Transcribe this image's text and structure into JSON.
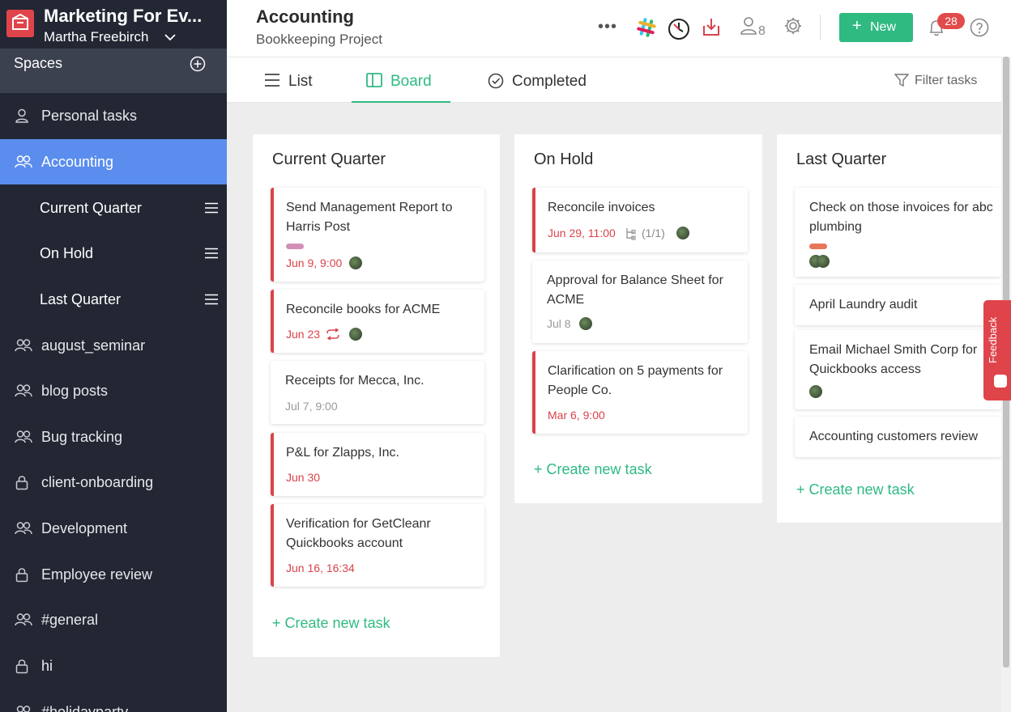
{
  "workspace": {
    "name": "Marketing For Ev...",
    "user": "Martha Freebirch"
  },
  "sidebar": {
    "spaces_label": "Spaces",
    "items": [
      {
        "label": "Personal tasks",
        "icon": "person-icon"
      },
      {
        "label": "Accounting",
        "icon": "people-icon",
        "active": true
      },
      {
        "label": "Current Quarter",
        "sub": true
      },
      {
        "label": "On Hold",
        "sub": true
      },
      {
        "label": "Last Quarter",
        "sub": true
      },
      {
        "label": "august_seminar",
        "icon": "people-icon"
      },
      {
        "label": "blog posts",
        "icon": "people-icon"
      },
      {
        "label": "Bug tracking",
        "icon": "people-icon"
      },
      {
        "label": "client-onboarding",
        "icon": "lock-icon"
      },
      {
        "label": "Development",
        "icon": "people-icon"
      },
      {
        "label": "Employee review",
        "icon": "lock-icon"
      },
      {
        "label": "#general",
        "icon": "people-icon"
      },
      {
        "label": "hi",
        "icon": "lock-icon"
      },
      {
        "label": "#holidayparty",
        "icon": "people-icon"
      }
    ]
  },
  "header": {
    "title": "Accounting",
    "subtitle": "Bookkeeping Project",
    "member_count": "8",
    "new_button": "New",
    "notifications": "28"
  },
  "tabs": [
    {
      "label": "List"
    },
    {
      "label": "Board",
      "active": true
    },
    {
      "label": "Completed"
    }
  ],
  "filter_label": "Filter tasks",
  "columns": [
    {
      "title": "Current Quarter",
      "create_label": "+ Create new task",
      "cards": [
        {
          "title": "Send Management Report to Harris Post",
          "date": "Jun 9, 9:00",
          "tag_color": "#d48fb8"
        },
        {
          "title": "Reconcile books for ACME",
          "date": "Jun 23"
        },
        {
          "title": "Receipts for Mecca, Inc.",
          "date": "Jul 7, 9:00"
        },
        {
          "title": "P&L for Zlapps, Inc.",
          "date": "Jun 30"
        },
        {
          "title": "Verification for GetCleanr Quickbooks account",
          "date": "Jun 16, 16:34"
        }
      ]
    },
    {
      "title": "On Hold",
      "create_label": "+ Create new task",
      "cards": [
        {
          "title": "Reconcile invoices",
          "date": "Jun 29, 11:00",
          "subtasks": "(1/1)"
        },
        {
          "title": "Approval for Balance Sheet for ACME",
          "date": "Jul 8"
        },
        {
          "title": "Clarification on 5 payments for People Co.",
          "date": "Mar 6, 9:00"
        }
      ]
    },
    {
      "title": "Last Quarter",
      "create_label": "+ Create new task",
      "cards": [
        {
          "title": "Check on those invoices  for abc plumbing",
          "tag_color": "#e8775a"
        },
        {
          "title": "April Laundry audit"
        },
        {
          "title": "Email Michael Smith Corp for Quickbooks access"
        },
        {
          "title": "Accounting customers review"
        }
      ]
    }
  ],
  "feedback_label": "Feedback",
  "colors": {
    "accent": "#2fba82",
    "active_nav": "#5a8dee",
    "danger": "#d9434a",
    "sidebar": "#222733"
  }
}
